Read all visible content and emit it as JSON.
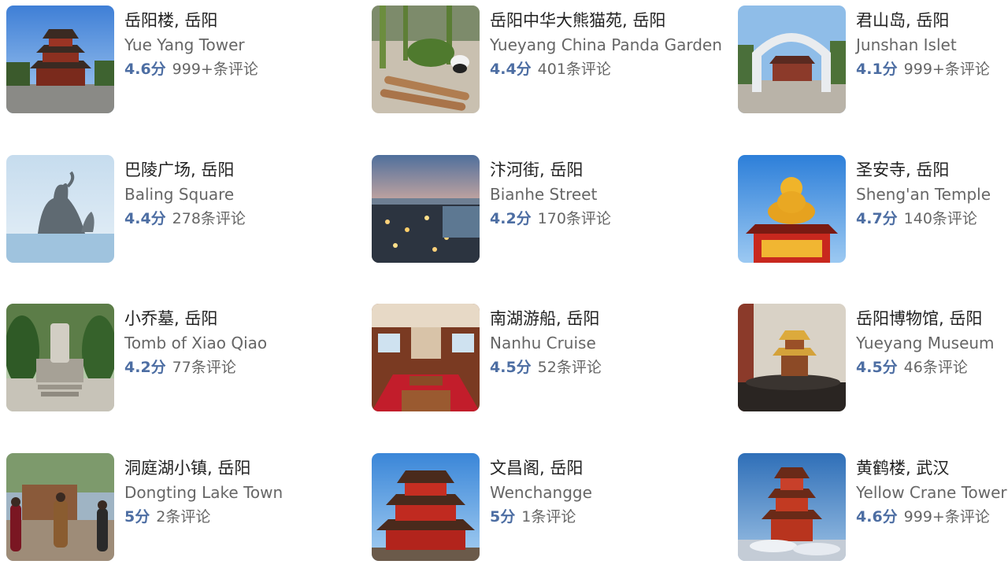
{
  "accent_color": "#4d6ea3",
  "attractions": [
    {
      "cn": "岳阳楼, 岳阳",
      "en": "Yue Yang Tower",
      "score": "4.6分",
      "reviews": "999+条评论",
      "image": "yueyang-tower-image"
    },
    {
      "cn": "岳阳中华大熊猫苑, 岳阳",
      "en": "Yueyang China Panda Garden",
      "score": "4.4分",
      "reviews": "401条评论",
      "image": "panda-garden-image"
    },
    {
      "cn": "君山岛, 岳阳",
      "en": "Junshan Islet",
      "score": "4.1分",
      "reviews": "999+条评论",
      "image": "junshan-islet-image"
    },
    {
      "cn": "巴陵广场, 岳阳",
      "en": "Baling Square",
      "score": "4.4分",
      "reviews": "278条评论",
      "image": "baling-square-image"
    },
    {
      "cn": "汴河街, 岳阳",
      "en": "Bianhe Street",
      "score": "4.2分",
      "reviews": "170条评论",
      "image": "bianhe-street-image"
    },
    {
      "cn": "圣安寺, 岳阳",
      "en": "Sheng'an Temple",
      "score": "4.7分",
      "reviews": "140条评论",
      "image": "shengan-temple-image"
    },
    {
      "cn": "小乔墓, 岳阳",
      "en": "Tomb of Xiao Qiao",
      "score": "4.2分",
      "reviews": "77条评论",
      "image": "xiao-qiao-tomb-image"
    },
    {
      "cn": "南湖游船, 岳阳",
      "en": "Nanhu Cruise",
      "score": "4.5分",
      "reviews": "52条评论",
      "image": "nanhu-cruise-image"
    },
    {
      "cn": "岳阳博物馆, 岳阳",
      "en": "Yueyang Museum",
      "score": "4.5分",
      "reviews": "46条评论",
      "image": "yueyang-museum-image"
    },
    {
      "cn": "洞庭湖小镇, 岳阳",
      "en": "Dongting Lake Town",
      "score": "5分",
      "reviews": "2条评论",
      "image": "dongting-town-image"
    },
    {
      "cn": "文昌阁, 岳阳",
      "en": "Wenchangge",
      "score": "5分",
      "reviews": "1条评论",
      "image": "wenchangge-image"
    },
    {
      "cn": "黄鹤楼, 武汉",
      "en": "Yellow Crane Tower",
      "score": "4.6分",
      "reviews": "999+条评论",
      "image": "yellow-crane-tower-image"
    }
  ]
}
